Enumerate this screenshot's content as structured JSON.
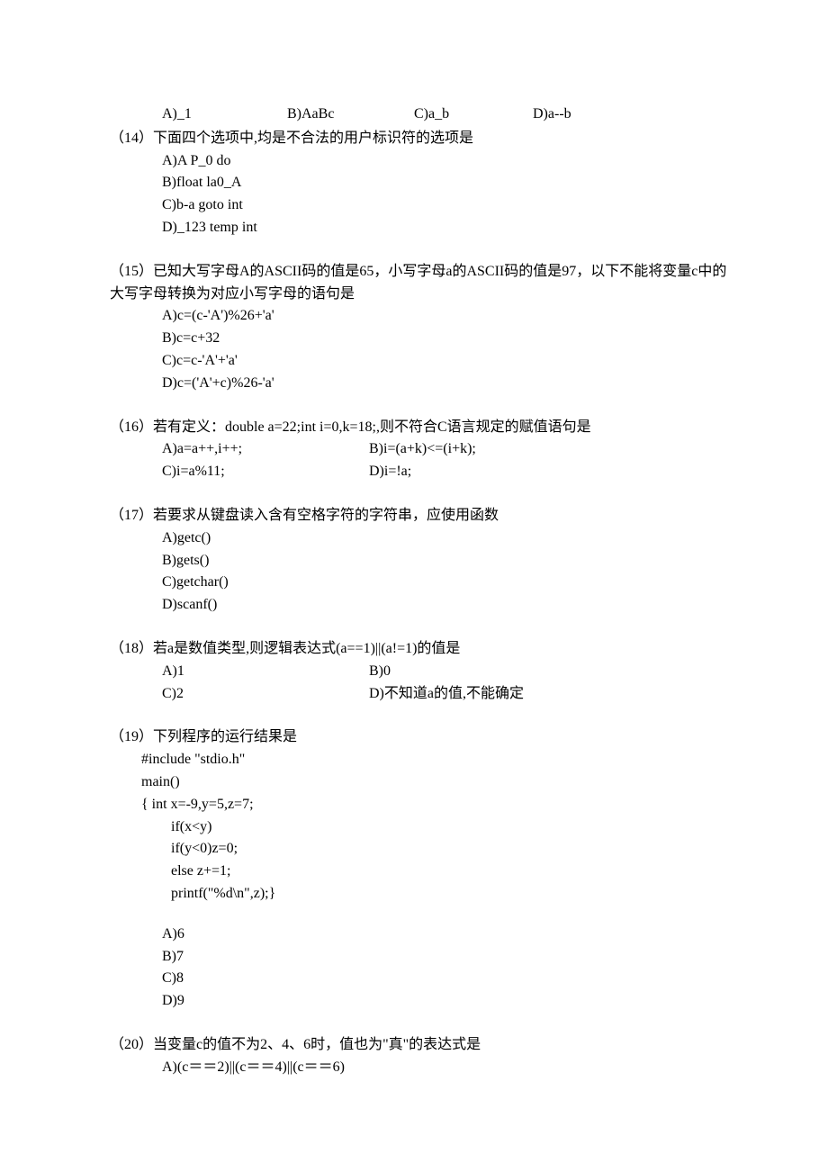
{
  "q13": {
    "opts": {
      "A": "A)_1",
      "B": "B)AaBc",
      "C": "C)a_b",
      "D": "D)a--b"
    }
  },
  "q14": {
    "stem": "（14）下面四个选项中,均是不合法的用户标识符的选项是",
    "A": "A)A P_0 do",
    "B": "B)float la0_A",
    "C": "C)b-a goto int",
    "D": "D)_123 temp int"
  },
  "q15": {
    "stem": "（15）已知大写字母A的ASCII码的值是65，小写字母a的ASCII码的值是97，以下不能将变量c中的大写字母转换为对应小写字母的语句是",
    "A": "A)c=(c-'A')%26+'a'",
    "B": "B)c=c+32",
    "C": "C)c=c-'A'+'a'",
    "D": "D)c=('A'+c)%26-'a'"
  },
  "q16": {
    "stem": "（16）若有定义：double a=22;int i=0,k=18;,则不符合C语言规定的赋值语句是",
    "A": "A)a=a++,i++;",
    "B": "B)i=(a+k)<=(i+k);",
    "C": "C)i=a%11;",
    "D": "D)i=!a;"
  },
  "q17": {
    "stem": "（17）若要求从键盘读入含有空格字符的字符串，应使用函数",
    "A": "A)getc()",
    "B": "B)gets()",
    "C": "C)getchar()",
    "D": "D)scanf()"
  },
  "q18": {
    "stem": "（18）若a是数值类型,则逻辑表达式(a==1)||(a!=1)的值是",
    "A": "A)1",
    "B": "B)0",
    "C": "C)2",
    "D": "D)不知道a的值,不能确定"
  },
  "q19": {
    "stem": "（19）下列程序的运行结果是",
    "code": {
      "l1": "#include \"stdio.h\"",
      "l2": "main()",
      "l3": "{    int x=-9,y=5,z=7;",
      "l4": "if(x<y)",
      "l5": "if(y<0)z=0;",
      "l6": "else z+=1;",
      "l7": "printf(\"%d\\n\",z);}"
    },
    "A": "A)6",
    "B": "B)7",
    "C": "C)8",
    "D": "D)9"
  },
  "q20": {
    "stem": "（20）当变量c的值不为2、4、6时，值也为\"真\"的表达式是",
    "A": "A)(c＝＝2)||(c＝＝4)||(c＝＝6)"
  }
}
